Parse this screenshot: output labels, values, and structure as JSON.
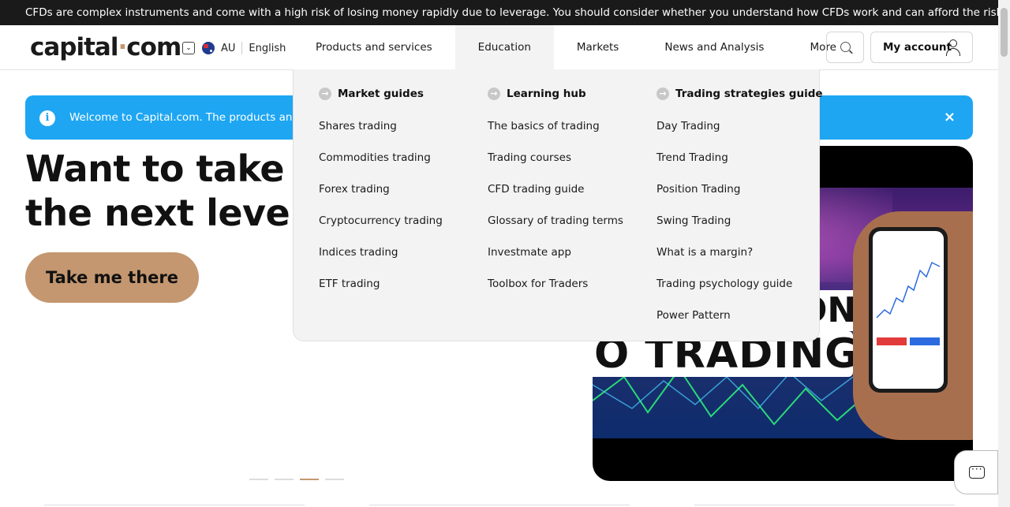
{
  "risk_warning": "CFDs are complex instruments and come with a high risk of losing money rapidly due to leverage. You should consider whether you understand how CFDs work and can afford the risks.",
  "header": {
    "logo_left": "capital",
    "logo_dot": "·",
    "logo_right": "com",
    "region": "AU",
    "language": "English",
    "nav": [
      "Products and services",
      "Education",
      "Markets",
      "News and Analysis",
      "More"
    ],
    "active_nav": "Education",
    "account_label": "My account"
  },
  "banner": {
    "text": "Welcome to Capital.com. The products and serv",
    "close": "×"
  },
  "hero": {
    "title_line1": "Want to take yo",
    "title_line2": "the next level?",
    "cta": "Take me there",
    "image_text_top": "ON",
    "image_text_bottom": "O TRADING"
  },
  "slider": {
    "count": 4,
    "active": 3
  },
  "mega_menu": {
    "columns": [
      {
        "heading": "Market guides",
        "items": [
          "Shares trading",
          "Commodities trading",
          "Forex trading",
          "Cryptocurrency trading",
          "Indices trading",
          "ETF trading"
        ]
      },
      {
        "heading": "Learning hub",
        "items": [
          "The basics of trading",
          "Trading courses",
          "CFD trading guide",
          "Glossary of trading terms",
          "Investmate app",
          "Toolbox for Traders"
        ]
      },
      {
        "heading": "Trading strategies guide",
        "items": [
          "Day Trading",
          "Trend Trading",
          "Position Trading",
          "Swing Trading",
          "What is a margin?",
          "Trading psychology guide",
          "Power Pattern"
        ]
      }
    ]
  },
  "colors": {
    "accent": "#c49770",
    "banner": "#1ea6f3",
    "risk_bar": "#1a1a1a"
  },
  "icons": [
    "chevron-down-icon",
    "au-flag-icon",
    "search-icon",
    "user-icon",
    "info-icon",
    "close-icon",
    "arrow-right-icon",
    "chat-icon"
  ]
}
